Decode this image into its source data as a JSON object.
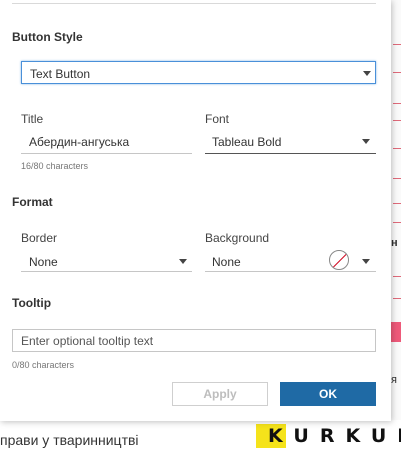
{
  "background": {
    "footer_text": "прави у тваринництві",
    "logo_text": "KURKUL",
    "edge_letters": [
      "н",
      "я"
    ],
    "accent_pink": "#ee5a7a",
    "logo_yellow": "#f5e31b"
  },
  "dialog": {
    "button_style": {
      "heading": "Button Style",
      "selected": "Text Button"
    },
    "title": {
      "label": "Title",
      "value": "Абердин-ангуська",
      "char_count": "16/80 characters"
    },
    "font": {
      "label": "Font",
      "selected": "Tableau Bold"
    },
    "format": {
      "heading": "Format",
      "border_label": "Border",
      "border_value": "None",
      "background_label": "Background",
      "background_value": "None",
      "swatch_icon": "no-color-swatch-icon"
    },
    "tooltip": {
      "heading": "Tooltip",
      "placeholder": "Enter optional tooltip text",
      "char_count": "0/80 characters"
    },
    "actions": {
      "apply_label": "Apply",
      "ok_label": "OK"
    },
    "colors": {
      "focus_blue": "#4a90d9",
      "ok_blue": "#1f6aa5"
    }
  }
}
